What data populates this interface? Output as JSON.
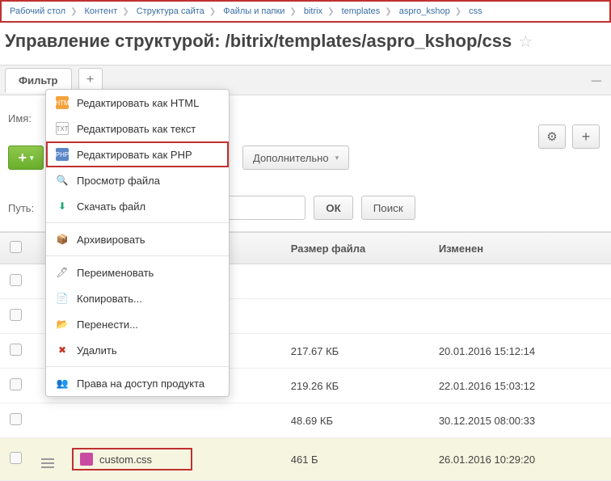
{
  "breadcrumb": {
    "items": [
      "Рабочий стол",
      "Контент",
      "Структура сайта",
      "Файлы и папки",
      "bitrix",
      "templates",
      "aspro_kshop",
      "css"
    ]
  },
  "page": {
    "title": "Управление структурой: /bitrix/templates/aspro_kshop/css"
  },
  "filter": {
    "tab_label": "Фильтр",
    "name_label": "Имя",
    "path_label": "Путь",
    "ok_label": "ОК",
    "search_label": "Поиск"
  },
  "toolbar": {
    "more_label": "Дополнительно"
  },
  "table": {
    "headers": {
      "size": "Размер файла",
      "modified": "Изменен"
    },
    "rows": [
      {
        "name": "",
        "size": "",
        "modified": ""
      },
      {
        "name": "",
        "size": "",
        "modified": ""
      },
      {
        "name": "",
        "size": "217.67 КБ",
        "modified": "20.01.2016 15:12:14"
      },
      {
        "name": "",
        "size": "219.26 КБ",
        "modified": "22.01.2016 15:03:12"
      },
      {
        "name": "",
        "size": "48.69 КБ",
        "modified": "30.12.2015 08:00:33"
      },
      {
        "name": "custom.css",
        "size": "461 Б",
        "modified": "26.01.2016 10:29:20"
      }
    ]
  },
  "context_menu": {
    "edit_html": "Редактировать как HTML",
    "edit_txt": "Редактировать как текст",
    "edit_php": "Редактировать как PHP",
    "view": "Просмотр файла",
    "download": "Скачать файл",
    "archive": "Архивировать",
    "rename": "Переименовать",
    "copy": "Копировать...",
    "move": "Перенести...",
    "delete": "Удалить",
    "perms": "Права на доступ продукта"
  }
}
